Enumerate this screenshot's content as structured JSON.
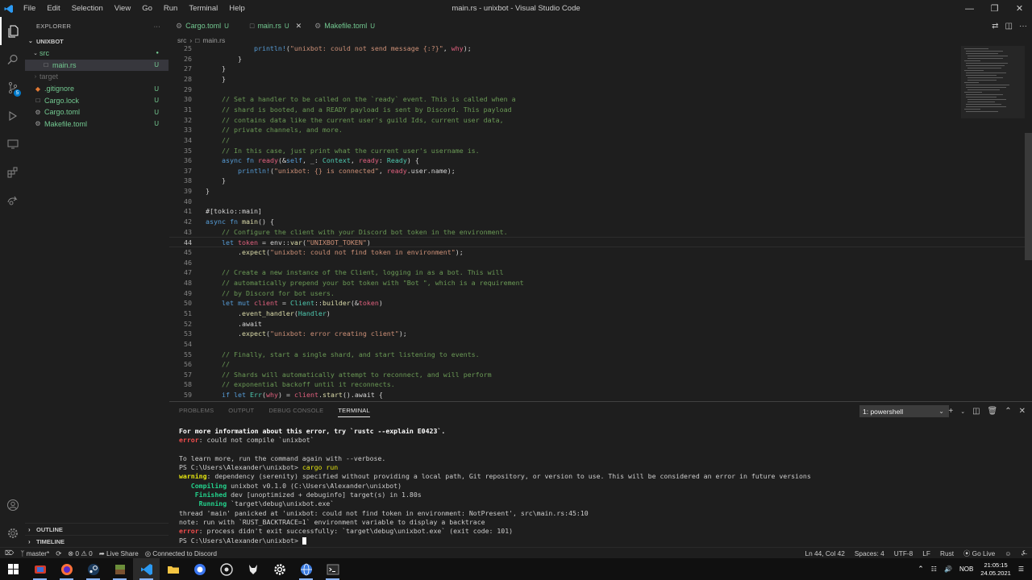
{
  "window": {
    "title": "main.rs - unixbot - Visual Studio Code",
    "menu": [
      "File",
      "Edit",
      "Selection",
      "View",
      "Go",
      "Run",
      "Terminal",
      "Help"
    ]
  },
  "activity_bar": {
    "scm_badge": "5"
  },
  "sidebar": {
    "header": "EXPLORER",
    "more": "···",
    "project": "UNIXBOT",
    "items": [
      {
        "label": "src",
        "status": "●"
      },
      {
        "label": "main.rs",
        "status": "U"
      },
      {
        "label": "target",
        "status": ""
      },
      {
        "label": ".gitignore",
        "status": "U"
      },
      {
        "label": "Cargo.lock",
        "status": "U"
      },
      {
        "label": "Cargo.toml",
        "status": "U"
      },
      {
        "label": "Makefile.toml",
        "status": "U"
      }
    ],
    "outline": "OUTLINE",
    "timeline": "TIMELINE"
  },
  "tabs": [
    {
      "label": "Cargo.toml",
      "status": "U"
    },
    {
      "label": "main.rs",
      "status": "U"
    },
    {
      "label": "Makefile.toml",
      "status": "U"
    }
  ],
  "breadcrumb": [
    "src",
    "main.rs"
  ],
  "editor": {
    "lines": [
      {
        "n": "25",
        "text": "            println!(\"unixbot: could not send message {:?}\", why);"
      },
      {
        "n": "26",
        "text": "        }"
      },
      {
        "n": "27",
        "text": "    }"
      },
      {
        "n": "28",
        "text": "    }"
      },
      {
        "n": "29",
        "text": ""
      },
      {
        "n": "30",
        "text": "    // Set a handler to be called on the `ready` event. This is called when a"
      },
      {
        "n": "31",
        "text": "    // shard is booted, and a READY payload is sent by Discord. This payload"
      },
      {
        "n": "32",
        "text": "    // contains data like the current user's guild Ids, current user data,"
      },
      {
        "n": "33",
        "text": "    // private channels, and more."
      },
      {
        "n": "34",
        "text": "    //"
      },
      {
        "n": "35",
        "text": "    // In this case, just print what the current user's username is."
      },
      {
        "n": "36",
        "text": "    async fn ready(&self, _: Context, ready: Ready) {"
      },
      {
        "n": "37",
        "text": "        println!(\"unixbot: {} is connected\", ready.user.name);"
      },
      {
        "n": "38",
        "text": "    }"
      },
      {
        "n": "39",
        "text": "}"
      },
      {
        "n": "40",
        "text": ""
      },
      {
        "n": "41",
        "text": "#[tokio::main]"
      },
      {
        "n": "42",
        "text": "async fn main() {"
      },
      {
        "n": "43",
        "text": "    // Configure the client with your Discord bot token in the environment."
      },
      {
        "n": "44",
        "text": "    let token = env::var(\"UNIXBOT_TOKEN\")"
      },
      {
        "n": "45",
        "text": "        .expect(\"unixbot: could not find token in environment\");"
      },
      {
        "n": "46",
        "text": ""
      },
      {
        "n": "47",
        "text": "    // Create a new instance of the Client, logging in as a bot. This will"
      },
      {
        "n": "48",
        "text": "    // automatically prepend your bot token with \"Bot \", which is a requirement"
      },
      {
        "n": "49",
        "text": "    // by Discord for bot users."
      },
      {
        "n": "50",
        "text": "    let mut client = Client::builder(&token)"
      },
      {
        "n": "51",
        "text": "        .event_handler(Handler)"
      },
      {
        "n": "52",
        "text": "        .await"
      },
      {
        "n": "53",
        "text": "        .expect(\"unixbot: error creating client\");"
      },
      {
        "n": "54",
        "text": ""
      },
      {
        "n": "55",
        "text": "    // Finally, start a single shard, and start listening to events."
      },
      {
        "n": "56",
        "text": "    //"
      },
      {
        "n": "57",
        "text": "    // Shards will automatically attempt to reconnect, and will perform"
      },
      {
        "n": "58",
        "text": "    // exponential backoff until it reconnects."
      },
      {
        "n": "59",
        "text": "    if let Err(why) = client.start().await {"
      }
    ]
  },
  "panel": {
    "tabs": [
      "PROBLEMS",
      "OUTPUT",
      "DEBUG CONSOLE",
      "TERMINAL"
    ],
    "terminal_select": "1: powershell",
    "terminal_lines": [
      {
        "text": "For more information about this error, try `rustc --explain E0423`."
      },
      {
        "prefix": "error",
        "text": ": could not compile `unixbot`"
      },
      {
        "text": ""
      },
      {
        "text": "To learn more, run the command again with --verbose."
      },
      {
        "prompt": "PS C:\\Users\\Alexander\\unixbot> ",
        "cmd": "cargo run"
      },
      {
        "prefix": "warning",
        "text": ": dependency (serenity) specified without providing a local path, Git repository, or version to use. This will be considered an error in future versions"
      },
      {
        "prefix": "   Compiling",
        "text": " unixbot v0.1.0 (C:\\Users\\Alexander\\unixbot)"
      },
      {
        "prefix": "    Finished",
        "text": " dev [unoptimized + debuginfo] target(s) in 1.80s"
      },
      {
        "prefix": "     Running",
        "text": " `target\\debug\\unixbot.exe`"
      },
      {
        "text": "thread 'main' panicked at 'unixbot: could not find token in environment: NotPresent', src\\main.rs:45:10"
      },
      {
        "text": "note: run with `RUST_BACKTRACE=1` environment variable to display a backtrace"
      },
      {
        "prefix": "error",
        "text": ": process didn't exit successfully: `target\\debug\\unixbot.exe` (exit code: 101)"
      },
      {
        "prompt": "PS C:\\Users\\Alexander\\unixbot> ",
        "cmd": ""
      }
    ]
  },
  "statusbar": {
    "branch": "master*",
    "problems_errors": "0",
    "problems_warnings": "0",
    "live_share": "Live Share",
    "discord": "Connected to Discord",
    "position": "Ln 44, Col 42",
    "spaces": "Spaces: 4",
    "encoding": "UTF-8",
    "eol": "LF",
    "language": "Rust",
    "go_live": "Go Live"
  },
  "taskbar": {
    "lang": "NOB",
    "time": "21:05:15",
    "date": "24.05.2021"
  },
  "colors": {
    "accent": "#007acc",
    "git_untracked": "#73c991",
    "error": "#f14c4c",
    "warning": "#e5e510"
  }
}
